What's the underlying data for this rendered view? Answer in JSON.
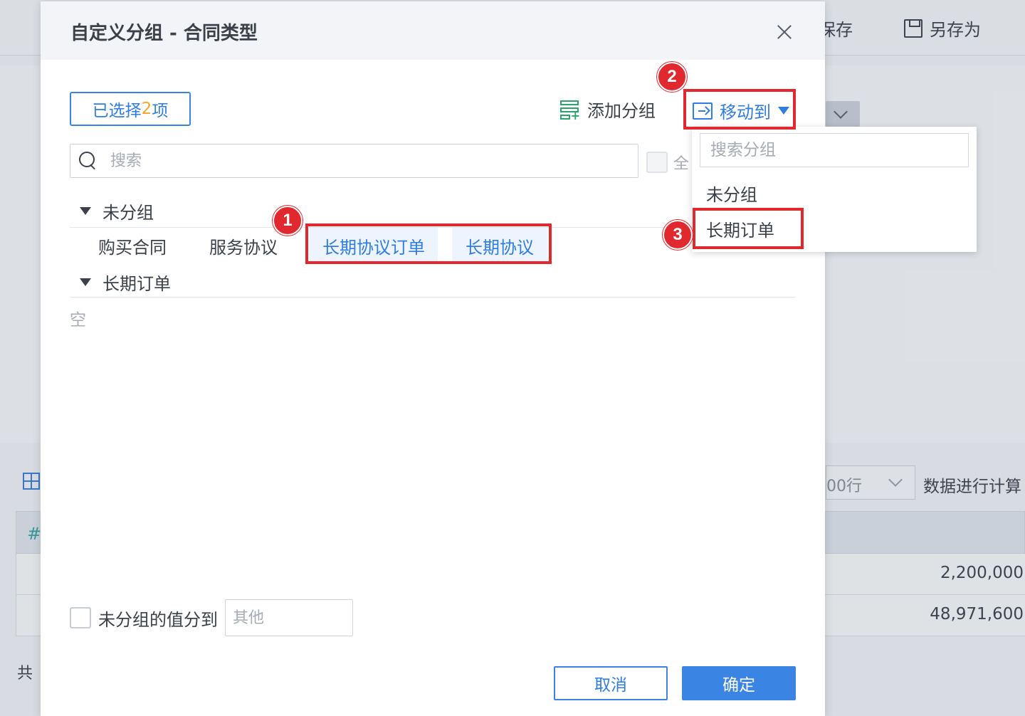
{
  "background": {
    "save_label": "保存",
    "save_as_label": "另存为",
    "rows_select_value": "00行",
    "calc_text": "数据进行计算",
    "table_values": [
      "2,200,000",
      "48,971,600"
    ],
    "footer_text": "共",
    "hash_symbol": "#"
  },
  "dialog": {
    "title": "自定义分组 - 合同类型",
    "selected_prefix": "已选择",
    "selected_count": "2",
    "selected_suffix": "项",
    "add_group_label": "添加分组",
    "move_to_label": "移动到",
    "search_placeholder": "搜索",
    "select_all_label": "全",
    "groups": [
      {
        "name": "未分组",
        "items": [
          {
            "label": "购买合同",
            "selected": false
          },
          {
            "label": "服务协议",
            "selected": false
          },
          {
            "label": "长期协议订单",
            "selected": true
          },
          {
            "label": "长期协议",
            "selected": true
          }
        ]
      },
      {
        "name": "长期订单",
        "empty_text": "空"
      }
    ],
    "ungrouped_label": "未分组的值分到",
    "ungrouped_placeholder": "其他",
    "cancel_label": "取消",
    "ok_label": "确定"
  },
  "dropdown": {
    "search_placeholder": "搜索分组",
    "items": [
      "未分组",
      "长期订单"
    ]
  },
  "annotations": {
    "badges": [
      "1",
      "2",
      "3"
    ],
    "color": "#e0282e"
  },
  "colors": {
    "accent": "#2f7de1",
    "count": "#f5a623",
    "add_group_icon": "#27a86a"
  }
}
